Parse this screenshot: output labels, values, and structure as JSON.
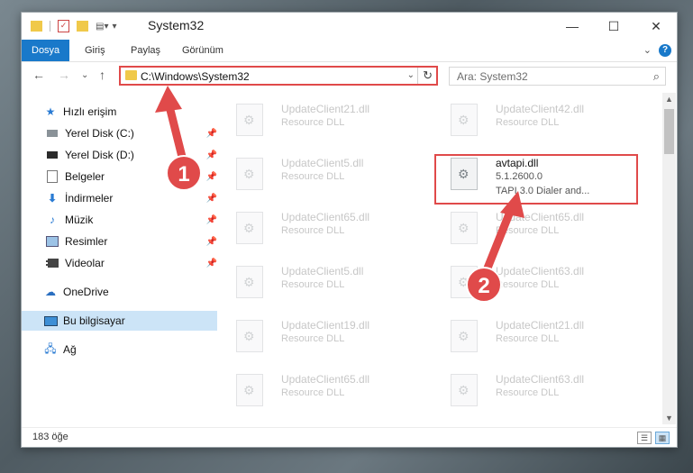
{
  "window": {
    "title": "System32",
    "controls": {
      "minimize": "—",
      "maximize": "☐",
      "close": "✕"
    }
  },
  "ribbon": {
    "tabs": [
      "Dosya",
      "Giriş",
      "Paylaş",
      "Görünüm"
    ],
    "help": "?"
  },
  "nav": {
    "address": "C:\\Windows\\System32",
    "search_placeholder": "Ara: System32"
  },
  "sidebar": {
    "items": [
      {
        "label": "Hızlı erişim",
        "icon": "star-icon"
      },
      {
        "label": "Yerel Disk (C:)",
        "icon": "drive-icon",
        "pinned": true
      },
      {
        "label": "Yerel Disk (D:)",
        "icon": "drive-icon",
        "pinned": true
      },
      {
        "label": "Belgeler",
        "icon": "documents-icon",
        "pinned": true
      },
      {
        "label": "İndirmeler",
        "icon": "download-icon",
        "pinned": true
      },
      {
        "label": "Müzik",
        "icon": "music-icon",
        "pinned": true
      },
      {
        "label": "Resimler",
        "icon": "pictures-icon",
        "pinned": true
      },
      {
        "label": "Videolar",
        "icon": "videos-icon",
        "pinned": true
      },
      {
        "label": "OneDrive",
        "icon": "cloud-icon"
      },
      {
        "label": "Bu bilgisayar",
        "icon": "computer-icon",
        "selected": true
      },
      {
        "label": "Ağ",
        "icon": "network-icon"
      }
    ]
  },
  "files": {
    "left": [
      {
        "name": "UpdateClient21.dll",
        "type": "Resource DLL"
      },
      {
        "name": "UpdateClient5.dll",
        "type": "Resource DLL"
      },
      {
        "name": "UpdateClient65.dll",
        "type": "Resource DLL"
      },
      {
        "name": "UpdateClient5.dll",
        "type": "Resource DLL"
      },
      {
        "name": "UpdateClient19.dll",
        "type": "Resource DLL"
      },
      {
        "name": "UpdateClient65.dll",
        "type": "Resource DLL"
      }
    ],
    "right": [
      {
        "name": "UpdateClient42.dll",
        "type": "Resource DLL"
      },
      {
        "name": "UpdateClient65.dll",
        "type": "Resource DLL"
      },
      {
        "name": "UpdateClient63.dll",
        "type": "Resource DLL"
      },
      {
        "name": "UpdateClient21.dll",
        "type": "Resource DLL"
      },
      {
        "name": "UpdateClient63.dll",
        "type": "Resource DLL"
      }
    ],
    "highlighted": {
      "name": "avtapi.dll",
      "version": "5.1.2600.0",
      "description": "TAPI 3.0 Dialer and..."
    }
  },
  "annotations": {
    "step1": "1",
    "step2": "2",
    "color": "#e04a4a"
  },
  "status": {
    "count": "183 öğe"
  }
}
